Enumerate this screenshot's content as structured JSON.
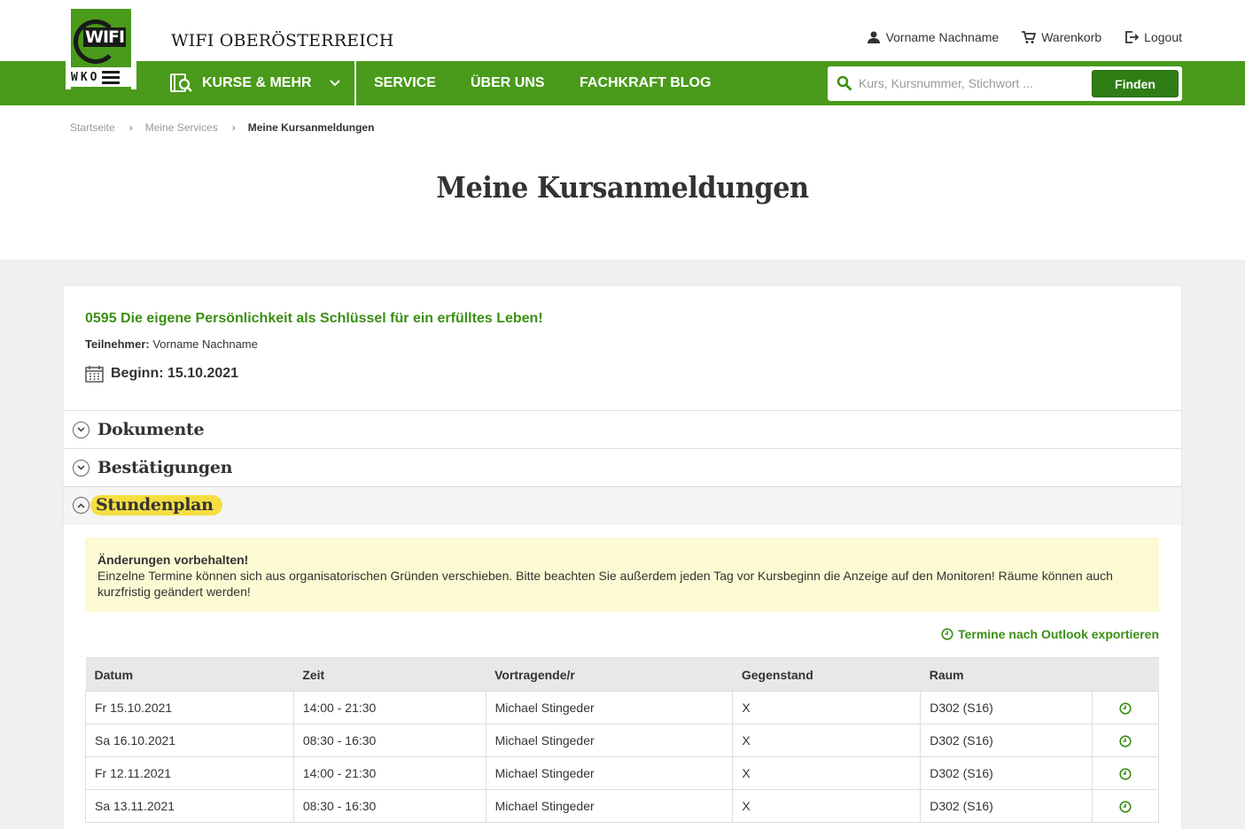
{
  "header": {
    "brand": "WIFI OBERÖSTERREICH",
    "logo_text": "WIFI",
    "logo_sub": "WKO",
    "user_label": "Vorname Nachname",
    "cart_label": "Warenkorb",
    "logout_label": "Logout"
  },
  "nav": {
    "kurse_label": "KURSE & MEHR",
    "service_label": "SERVICE",
    "ueber_label": "ÜBER UNS",
    "blog_label": "FACHKRAFT BLOG",
    "search_placeholder": "Kurs, Kursnummer, Stichwort ...",
    "search_button": "Finden"
  },
  "breadcrumb": {
    "home": "Startseite",
    "services": "Meine Services",
    "current": "Meine Kursanmeldungen",
    "separator": "›"
  },
  "page_title": "Meine Kursanmeldungen",
  "course": {
    "title": "0595 Die eigene Persönlichkeit als Schlüssel für ein erfülltes Leben!",
    "participant_label": "Teilnehmer:",
    "participant_name": "Vorname Nachname",
    "begin": "Beginn: 15.10.2021"
  },
  "accordion": {
    "documents": "Dokumente",
    "confirmations": "Bestätigungen",
    "schedule": "Stundenplan"
  },
  "notice": {
    "title": "Änderungen vorbehalten!",
    "text": "Einzelne Termine können sich aus organisatorischen Gründen verschieben. Bitte beachten Sie außerdem jeden Tag vor Kursbeginn die Anzeige auf den Monitoren! Räume können auch kurzfristig geändert werden!"
  },
  "export_label": "Termine nach Outlook exportieren",
  "table": {
    "headers": [
      "Datum",
      "Zeit",
      "Vortragende/r",
      "Gegenstand",
      "Raum",
      ""
    ],
    "rows": [
      [
        "Fr 15.10.2021",
        "14:00 - 21:30",
        "Michael Stingeder",
        "X",
        "D302 (S16)"
      ],
      [
        "Sa 16.10.2021",
        "08:30 - 16:30",
        "Michael Stingeder",
        "X",
        "D302 (S16)"
      ],
      [
        "Fr 12.11.2021",
        "14:00 - 21:30",
        "Michael Stingeder",
        "X",
        "D302 (S16)"
      ],
      [
        "Sa 13.11.2021",
        "08:30 - 16:30",
        "Michael Stingeder",
        "X",
        "D302 (S16)"
      ]
    ]
  },
  "colors": {
    "brand_green": "#4a9a1b",
    "button_green": "#2f7d15",
    "highlight_yellow": "#f6dd42",
    "notice_bg": "#fcfad3"
  }
}
